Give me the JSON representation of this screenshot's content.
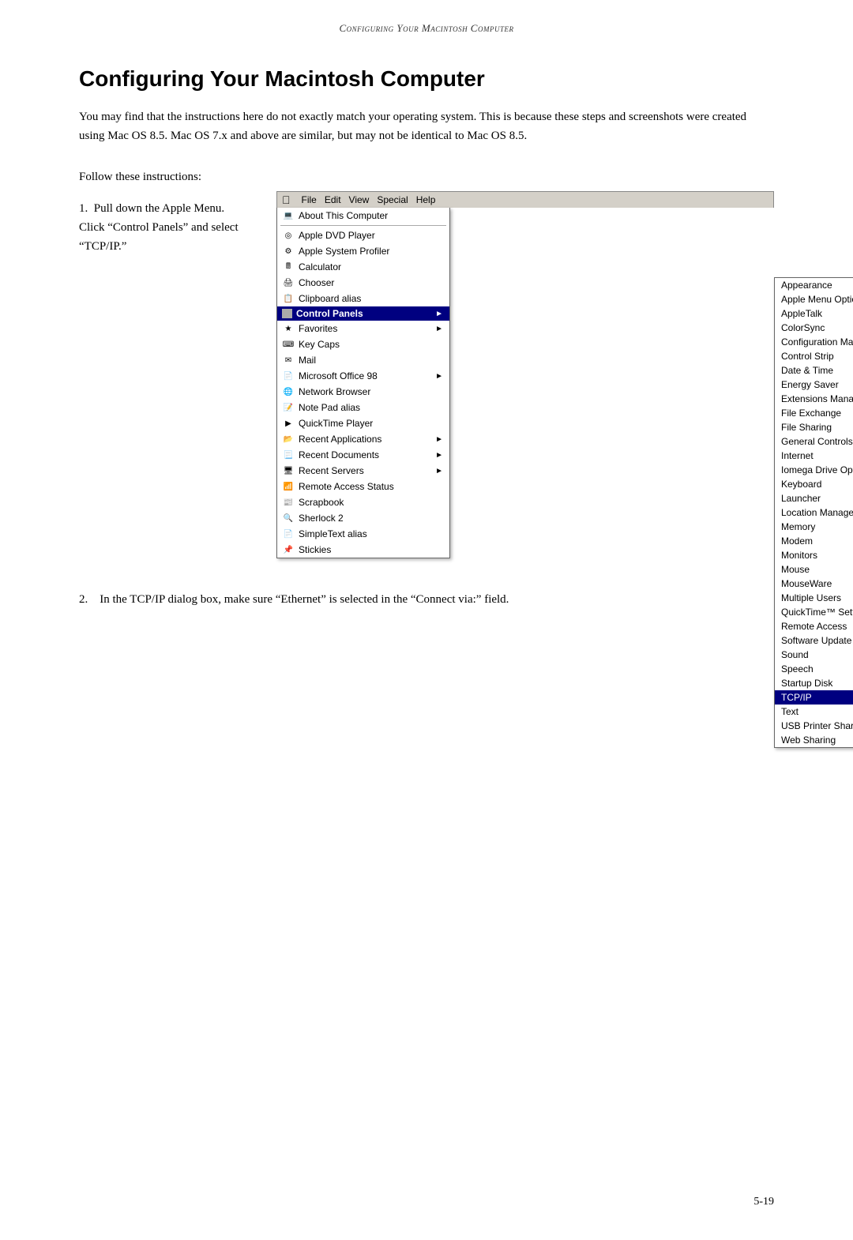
{
  "header": {
    "title": "Configuring Your Macintosh Computer"
  },
  "chapter": {
    "title": "Configuring Your Macintosh Computer",
    "intro": "You may find that the instructions here do not exactly match your operating system. This is because these steps and screenshots were created using Mac OS 8.5. Mac OS 7.x and above are similar, but may not be identical to Mac OS 8.5.",
    "follow_text": "Follow these instructions:"
  },
  "steps": [
    {
      "number": "1.",
      "text": "Pull down the Apple Menu. Click “Control Panels” and select “TCP/IP.”"
    },
    {
      "number": "2.",
      "text": "In the TCP/IP dialog box, make sure “Ethernet” is selected in the “Connect via:” field."
    }
  ],
  "menubar": {
    "apple": "",
    "items": [
      "File",
      "Edit",
      "View",
      "Special",
      "Help"
    ]
  },
  "apple_menu": [
    {
      "label": "About This Computer",
      "icon": "computer",
      "hasSubmenu": false
    },
    {
      "label": "Apple DVD Player",
      "icon": "dvd",
      "hasSubmenu": false
    },
    {
      "label": "Apple System Profiler",
      "icon": "profiler",
      "hasSubmenu": false
    },
    {
      "label": "Calculator",
      "icon": "calc",
      "hasSubmenu": false
    },
    {
      "label": "Chooser",
      "icon": "chooser",
      "hasSubmenu": false
    },
    {
      "label": "Clipboard alias",
      "icon": "clipboard",
      "hasSubmenu": false
    },
    {
      "label": "Control Panels",
      "icon": "controlpanels",
      "hasSubmenu": true,
      "highlighted": true
    },
    {
      "label": "Favorites",
      "icon": "favorites",
      "hasSubmenu": true
    },
    {
      "label": "Key Caps",
      "icon": "keycaps",
      "hasSubmenu": false
    },
    {
      "label": "Mail",
      "icon": "mail",
      "hasSubmenu": false
    },
    {
      "label": "Microsoft Office 98",
      "icon": "office",
      "hasSubmenu": true
    },
    {
      "label": "Network Browser",
      "icon": "network",
      "hasSubmenu": false
    },
    {
      "label": "Note Pad alias",
      "icon": "notepad",
      "hasSubmenu": false
    },
    {
      "label": "QuickTime Player",
      "icon": "quicktime",
      "hasSubmenu": false
    },
    {
      "label": "Recent Applications",
      "icon": "recent",
      "hasSubmenu": true
    },
    {
      "label": "Recent Documents",
      "icon": "recent",
      "hasSubmenu": true
    },
    {
      "label": "Recent Servers",
      "icon": "recent",
      "hasSubmenu": true
    },
    {
      "label": "Remote Access Status",
      "icon": "remote",
      "hasSubmenu": false
    },
    {
      "label": "Scrapbook",
      "icon": "scrapbook",
      "hasSubmenu": false
    },
    {
      "label": "Sherlock 2",
      "icon": "sherlock",
      "hasSubmenu": false
    },
    {
      "label": "SimpleText alias",
      "icon": "simpletext",
      "hasSubmenu": false
    },
    {
      "label": "Stickies",
      "icon": "stickies",
      "hasSubmenu": false
    }
  ],
  "control_panels_submenu": [
    {
      "label": "Appearance",
      "selected": false
    },
    {
      "label": "Apple Menu Options",
      "selected": false
    },
    {
      "label": "AppleTalk",
      "selected": false
    },
    {
      "label": "ColorSync",
      "selected": false
    },
    {
      "label": "Configuration Manager",
      "selected": false
    },
    {
      "label": "Control Strip",
      "selected": false
    },
    {
      "label": "Date & Time",
      "selected": false
    },
    {
      "label": "Energy Saver",
      "selected": false
    },
    {
      "label": "Extensions Manager",
      "selected": false
    },
    {
      "label": "File Exchange",
      "selected": false
    },
    {
      "label": "File Sharing",
      "selected": false
    },
    {
      "label": "General Controls",
      "selected": false
    },
    {
      "label": "Internet",
      "selected": false
    },
    {
      "label": "Iomega Drive Options",
      "selected": false
    },
    {
      "label": "Keyboard",
      "selected": false
    },
    {
      "label": "Launcher",
      "selected": false
    },
    {
      "label": "Location Manager",
      "selected": false
    },
    {
      "label": "Memory",
      "selected": false
    },
    {
      "label": "Modem",
      "selected": false
    },
    {
      "label": "Monitors",
      "selected": false
    },
    {
      "label": "Mouse",
      "selected": false
    },
    {
      "label": "MouseWare",
      "selected": false
    },
    {
      "label": "Multiple Users",
      "selected": false
    },
    {
      "label": "QuickTime™ Settings",
      "selected": false
    },
    {
      "label": "Remote Access",
      "selected": false
    },
    {
      "label": "Software Update",
      "selected": false
    },
    {
      "label": "Sound",
      "selected": false
    },
    {
      "label": "Speech",
      "selected": false
    },
    {
      "label": "Startup Disk",
      "selected": false
    },
    {
      "label": "TCP/IP",
      "selected": true
    },
    {
      "label": "Text",
      "selected": false
    },
    {
      "label": "USB Printer Sharing",
      "selected": false
    },
    {
      "label": "Web Sharing",
      "selected": false
    }
  ],
  "page_number": "5-19"
}
